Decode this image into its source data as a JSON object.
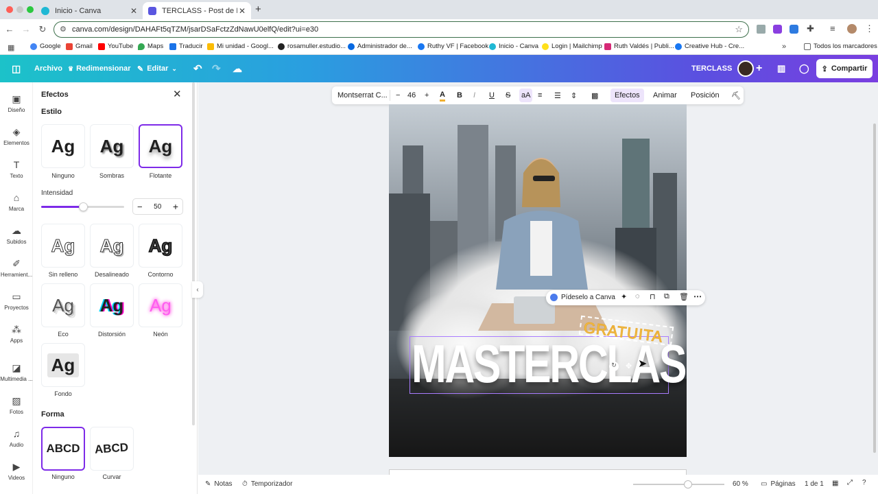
{
  "browser": {
    "tabs": [
      {
        "title": "Inicio - Canva"
      },
      {
        "title": "TERCLASS - Post de Instagram"
      }
    ],
    "url": "canva.com/design/DAHAFt5qTZM/jsarDSaFctzZdNawU0elfQ/edit?ui=e30",
    "bookmarks": [
      "Google",
      "Gmail",
      "YouTube",
      "Maps",
      "Traducir",
      "Mi unidad - Googl...",
      "rosamuller.estudio...",
      "Administrador de...",
      "Ruthy VF | Facebook",
      "Inicio - Canva",
      "Login | Mailchimp",
      "Ruth Valdés | Publi...",
      "Creative Hub - Cre..."
    ],
    "all_bookmarks": "Todos los marcadores"
  },
  "header": {
    "file": "Archivo",
    "resize": "Redimensionar",
    "edit": "Editar",
    "project_name": "TERCLASS",
    "share": "Compartir"
  },
  "rail": [
    "Diseño",
    "Elementos",
    "Texto",
    "Marca",
    "Subidos",
    "Herramient...",
    "Proyectos",
    "Apps",
    "Multimedia ...",
    "Fotos",
    "Audio",
    "Videos"
  ],
  "panel": {
    "title": "Efectos",
    "style_title": "Estilo",
    "sample": "Ag",
    "styles": [
      "Ninguno",
      "Sombras",
      "Flotante",
      "Sin relleno",
      "Desalineado",
      "Contorno",
      "Eco",
      "Distorsión",
      "Neón",
      "Fondo"
    ],
    "intensity_label": "Intensidad",
    "intensity": 50,
    "intensity_fraction": 0.5,
    "shape_title": "Forma",
    "shape_sample": "ABCD",
    "shapes": [
      "Ninguno",
      "Curvar"
    ]
  },
  "toolbar": {
    "font": "Montserrat C...",
    "size": "46",
    "effects": "Efectos",
    "animate": "Animar",
    "position": "Posición"
  },
  "design": {
    "headline": "MASTERCLASS",
    "subline": "GRATUITA"
  },
  "floatbar": {
    "ask": "Pídeselo a Canva"
  },
  "footer": {
    "notes": "Notas",
    "timer": "Temporizador",
    "zoom": "60 %",
    "zoom_fraction": 0.6,
    "pages": "Páginas",
    "page_count": "1 de 1"
  },
  "colors": {
    "accent": "#7d2ae8",
    "header_start": "#1cc2c9",
    "header_end": "#7a3fe0"
  }
}
